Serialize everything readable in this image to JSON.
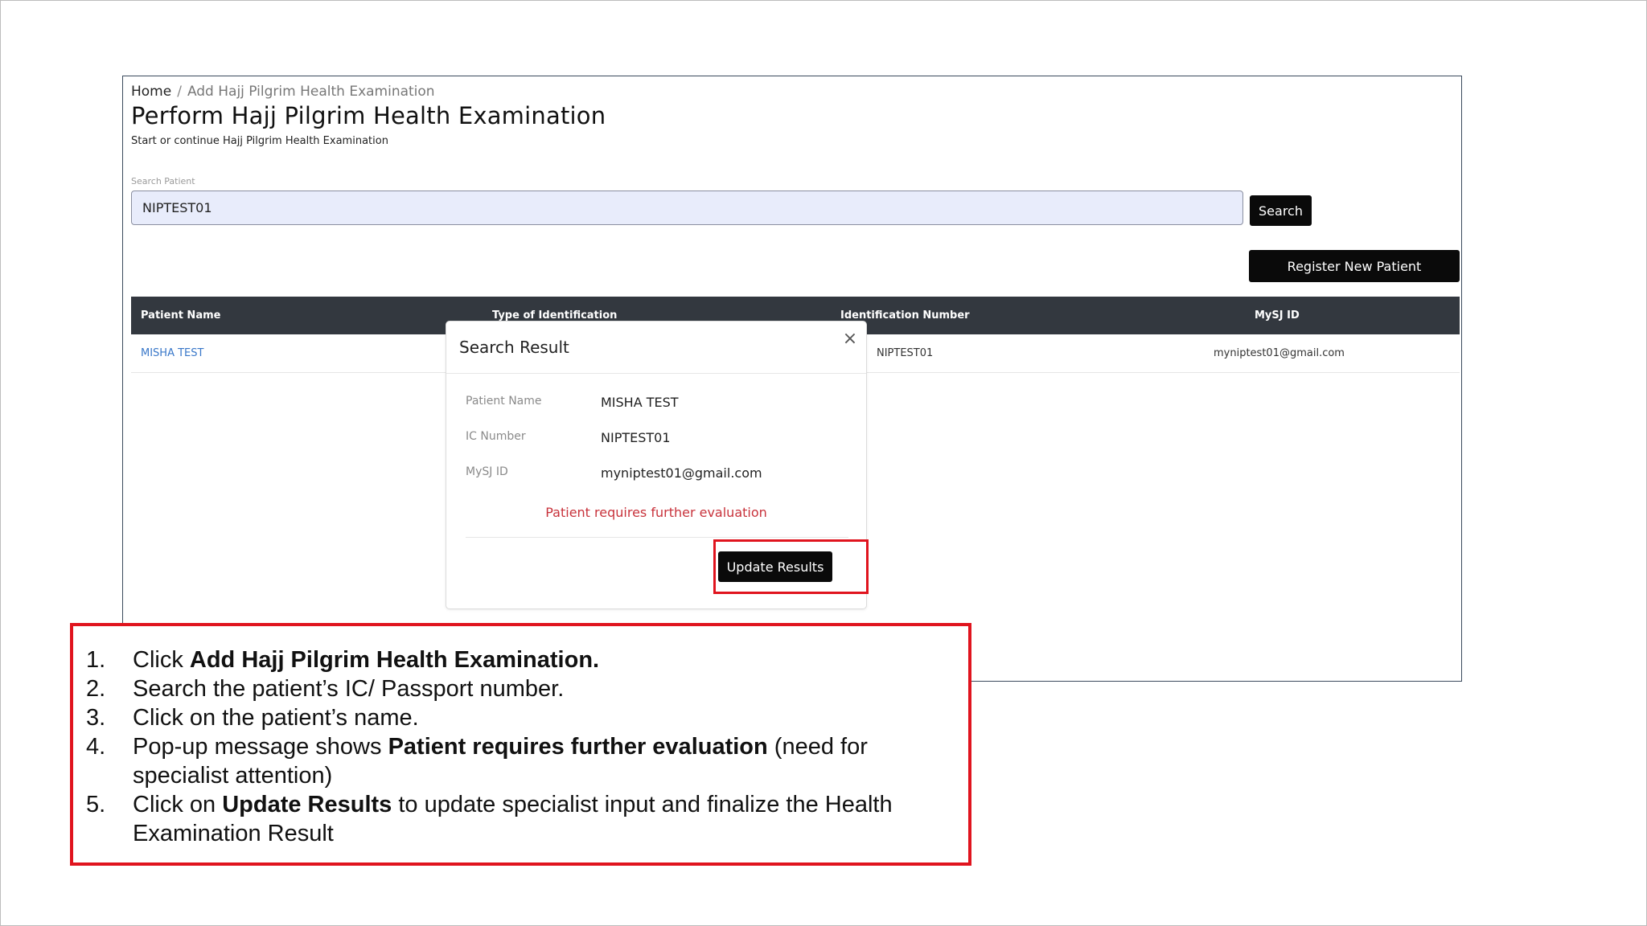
{
  "breadcrumb": {
    "home": "Home",
    "separator": "/",
    "current": "Add Hajj Pilgrim Health Examination"
  },
  "page": {
    "title": "Perform Hajj Pilgrim Health Examination",
    "subtitle": "Start or continue Hajj Pilgrim Health Examination"
  },
  "search": {
    "label": "Search Patient",
    "value": "NIPTEST01",
    "button_label": "Search"
  },
  "register_button_label": "Register New Patient",
  "table": {
    "headers": [
      "Patient Name",
      "Type of Identification",
      "Identification Number",
      "MySJ ID"
    ],
    "rows": [
      {
        "patient_name": "MISHA TEST",
        "identification_number": "NIPTEST01",
        "mysj_id": "myniptest01@gmail.com"
      }
    ]
  },
  "modal": {
    "title": "Search Result",
    "close_icon": "close-icon",
    "fields": [
      {
        "label": "Patient Name",
        "value": "MISHA TEST"
      },
      {
        "label": "IC Number",
        "value": "NIPTEST01"
      },
      {
        "label": "MySJ ID",
        "value": "myniptest01@gmail.com"
      }
    ],
    "warning": "Patient requires further evaluation",
    "update_button_label": "Update Results"
  },
  "instructions": [
    {
      "num": "1.",
      "pre": "Click ",
      "bold": "Add Hajj Pilgrim Health Examination.",
      "post": ""
    },
    {
      "num": "2.",
      "pre": "Search the patient’s IC/ Passport number.",
      "bold": "",
      "post": ""
    },
    {
      "num": "3.",
      "pre": "Click on the patient’s name.",
      "bold": "",
      "post": ""
    },
    {
      "num": "4.",
      "pre": "Pop-up message shows ",
      "bold": "Patient requires further evaluation",
      "post": " (need for specialist attention)"
    },
    {
      "num": "5.",
      "pre": "Click on ",
      "bold": "Update Results",
      "post": " to update specialist input and finalize the Health Examination Result"
    }
  ],
  "colors": {
    "highlight_red": "#e0141e",
    "warning_red": "#c8323b",
    "link_blue": "#3a78c9",
    "table_header_bg": "#33383f",
    "input_bg": "#e8ecfb"
  }
}
